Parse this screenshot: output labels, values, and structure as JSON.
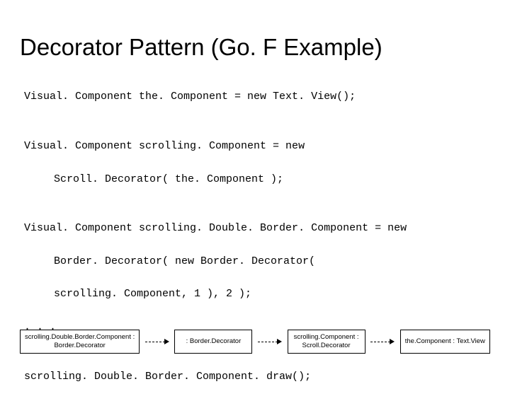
{
  "title": "Decorator Pattern (Go. F Example)",
  "code": {
    "l1": "Visual. Component the. Component = new Text. View();",
    "l2": "Visual. Component scrolling. Component = new",
    "l3": "Scroll. Decorator( the. Component );",
    "l4": "Visual. Component scrolling. Double. Border. Component = new",
    "l5": "Border. Decorator( new Border. Decorator(",
    "l6": "scrolling. Component, 1 ), 2 );",
    "dots": ". . .",
    "l7": "scrolling. Double. Border. Component. draw();"
  },
  "diagram": {
    "box1_line1": "scrolling.Double.Border.Component :",
    "box1_line2": "Border.Decorator",
    "box2_line1": ": Border.Decorator",
    "box3_line1": "scrolling.Component :",
    "box3_line2": "Scroll.Decorator",
    "box4_line1": "the.Component : Text.View"
  }
}
